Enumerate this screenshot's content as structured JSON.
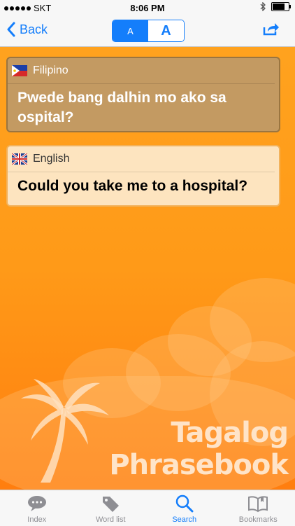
{
  "status": {
    "carrier": "SKT",
    "time": "8:06 PM"
  },
  "nav": {
    "back_label": "Back",
    "font_small": "A",
    "font_large": "A"
  },
  "cards": [
    {
      "language": "Filipino",
      "text": "Pwede bang dalhin mo ako sa ospital?"
    },
    {
      "language": "English",
      "text": "Could you take me to a hospital?"
    }
  ],
  "app_title": {
    "line1": "Tagalog",
    "line2": "Phrasebook"
  },
  "tabs": [
    {
      "label": "Index",
      "icon": "speech-bubble-icon"
    },
    {
      "label": "Word list",
      "icon": "tag-icon"
    },
    {
      "label": "Search",
      "icon": "search-icon",
      "active": true
    },
    {
      "label": "Bookmarks",
      "icon": "book-icon"
    }
  ],
  "colors": {
    "accent": "#147efb",
    "background": "#ff8c1a"
  }
}
